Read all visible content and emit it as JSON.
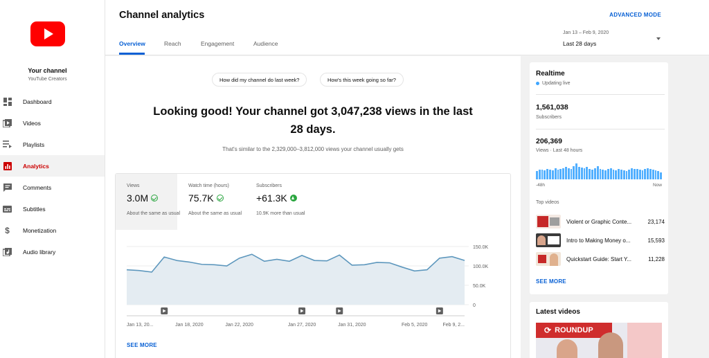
{
  "sidebar": {
    "channel_name": "Your channel",
    "channel_sub": "YouTube Creators",
    "items": [
      {
        "label": "Dashboard",
        "icon": "dashboard-icon"
      },
      {
        "label": "Videos",
        "icon": "videos-icon"
      },
      {
        "label": "Playlists",
        "icon": "playlists-icon"
      },
      {
        "label": "Analytics",
        "icon": "analytics-icon",
        "active": true
      },
      {
        "label": "Comments",
        "icon": "comments-icon"
      },
      {
        "label": "Subtitles",
        "icon": "subtitles-icon"
      },
      {
        "label": "Monetization",
        "icon": "dollar-icon"
      },
      {
        "label": "Audio library",
        "icon": "audio-library-icon"
      }
    ]
  },
  "header": {
    "title": "Channel analytics",
    "advanced_mode": "ADVANCED MODE",
    "tabs": [
      "Overview",
      "Reach",
      "Engagement",
      "Audience"
    ],
    "date_range": "Jan 13 – Feb 9, 2020",
    "date_label": "Last 28 days"
  },
  "main": {
    "chips": [
      "How did my channel do last week?",
      "How's this week going so far?"
    ],
    "headline": "Looking good! Your channel got 3,047,238 views in the last 28 days.",
    "similar": "That's similar to the 2,329,000–3,812,000 views your channel usually gets",
    "metrics": [
      {
        "label": "Views",
        "value": "3.0M",
        "note": "About the same as usual",
        "icon": "check-circle-icon"
      },
      {
        "label": "Watch time (hours)",
        "value": "75.7K",
        "note": "About the same as usual",
        "icon": "check-circle-icon"
      },
      {
        "label": "Subscribers",
        "value": "+61.3K",
        "note": "10.9K more than usual",
        "icon": "arrow-up-circle-icon"
      }
    ],
    "see_more": "SEE MORE"
  },
  "chart_data": {
    "type": "area",
    "y_ticks": [
      "150.0K",
      "100.0K",
      "50.0K",
      "0"
    ],
    "ylim": [
      0,
      150000
    ],
    "x_ticks": [
      "Jan 13, 20...",
      "Jan 18, 2020",
      "Jan 22, 2020",
      "Jan 27, 2020",
      "Jan 31, 2020",
      "Feb 5, 2020",
      "Feb 9, 2..."
    ],
    "x_tick_days": [
      0,
      5,
      9,
      14,
      18,
      23,
      27
    ],
    "x_range_days": [
      0,
      27
    ],
    "series": [
      {
        "values": [
          90000,
          88000,
          84000,
          123000,
          114000,
          110000,
          104000,
          103000,
          100000,
          120000,
          130000,
          112000,
          117000,
          112000,
          127000,
          114000,
          113000,
          128000,
          102000,
          103000,
          109000,
          108000,
          97000,
          87000,
          90000,
          120000,
          124000,
          114000
        ]
      }
    ],
    "markers_days": [
      3,
      14,
      17,
      25
    ],
    "colors": {
      "line": "#5d97bd",
      "fill": "#e4ecf2"
    }
  },
  "realtime": {
    "title": "Realtime",
    "live": "Updating live",
    "subscribers": "1,561,038",
    "subscribers_label": "Subscribers",
    "views": "206,369",
    "views_label": "Views · Last 48 hours",
    "spark": [
      12,
      14,
      14,
      13,
      15,
      14,
      13,
      16,
      14,
      15,
      16,
      18,
      16,
      15,
      19,
      23,
      18,
      17,
      16,
      18,
      15,
      14,
      16,
      19,
      15,
      14,
      13,
      15,
      16,
      14,
      13,
      15,
      14,
      13,
      12,
      14,
      16,
      15,
      15,
      14,
      13,
      15,
      16,
      15,
      14,
      13,
      12,
      10
    ],
    "axis_left": "-48h",
    "axis_right": "Now",
    "top_videos_title": "Top videos",
    "top_videos": [
      {
        "title": "Violent or Graphic Conte...",
        "views": "23,174"
      },
      {
        "title": "Intro to Making Money o...",
        "views": "15,593"
      },
      {
        "title": "Quickstart Guide: Start Y...",
        "views": "11,228"
      }
    ],
    "see_more": "SEE MORE"
  },
  "latest": {
    "title": "Latest videos",
    "thumb_text": "ROUNDUP"
  },
  "colors": {
    "accent": "#065fd4",
    "brand": "#ff0000",
    "active_nav": "#cc0000",
    "success": "#2ba640"
  }
}
